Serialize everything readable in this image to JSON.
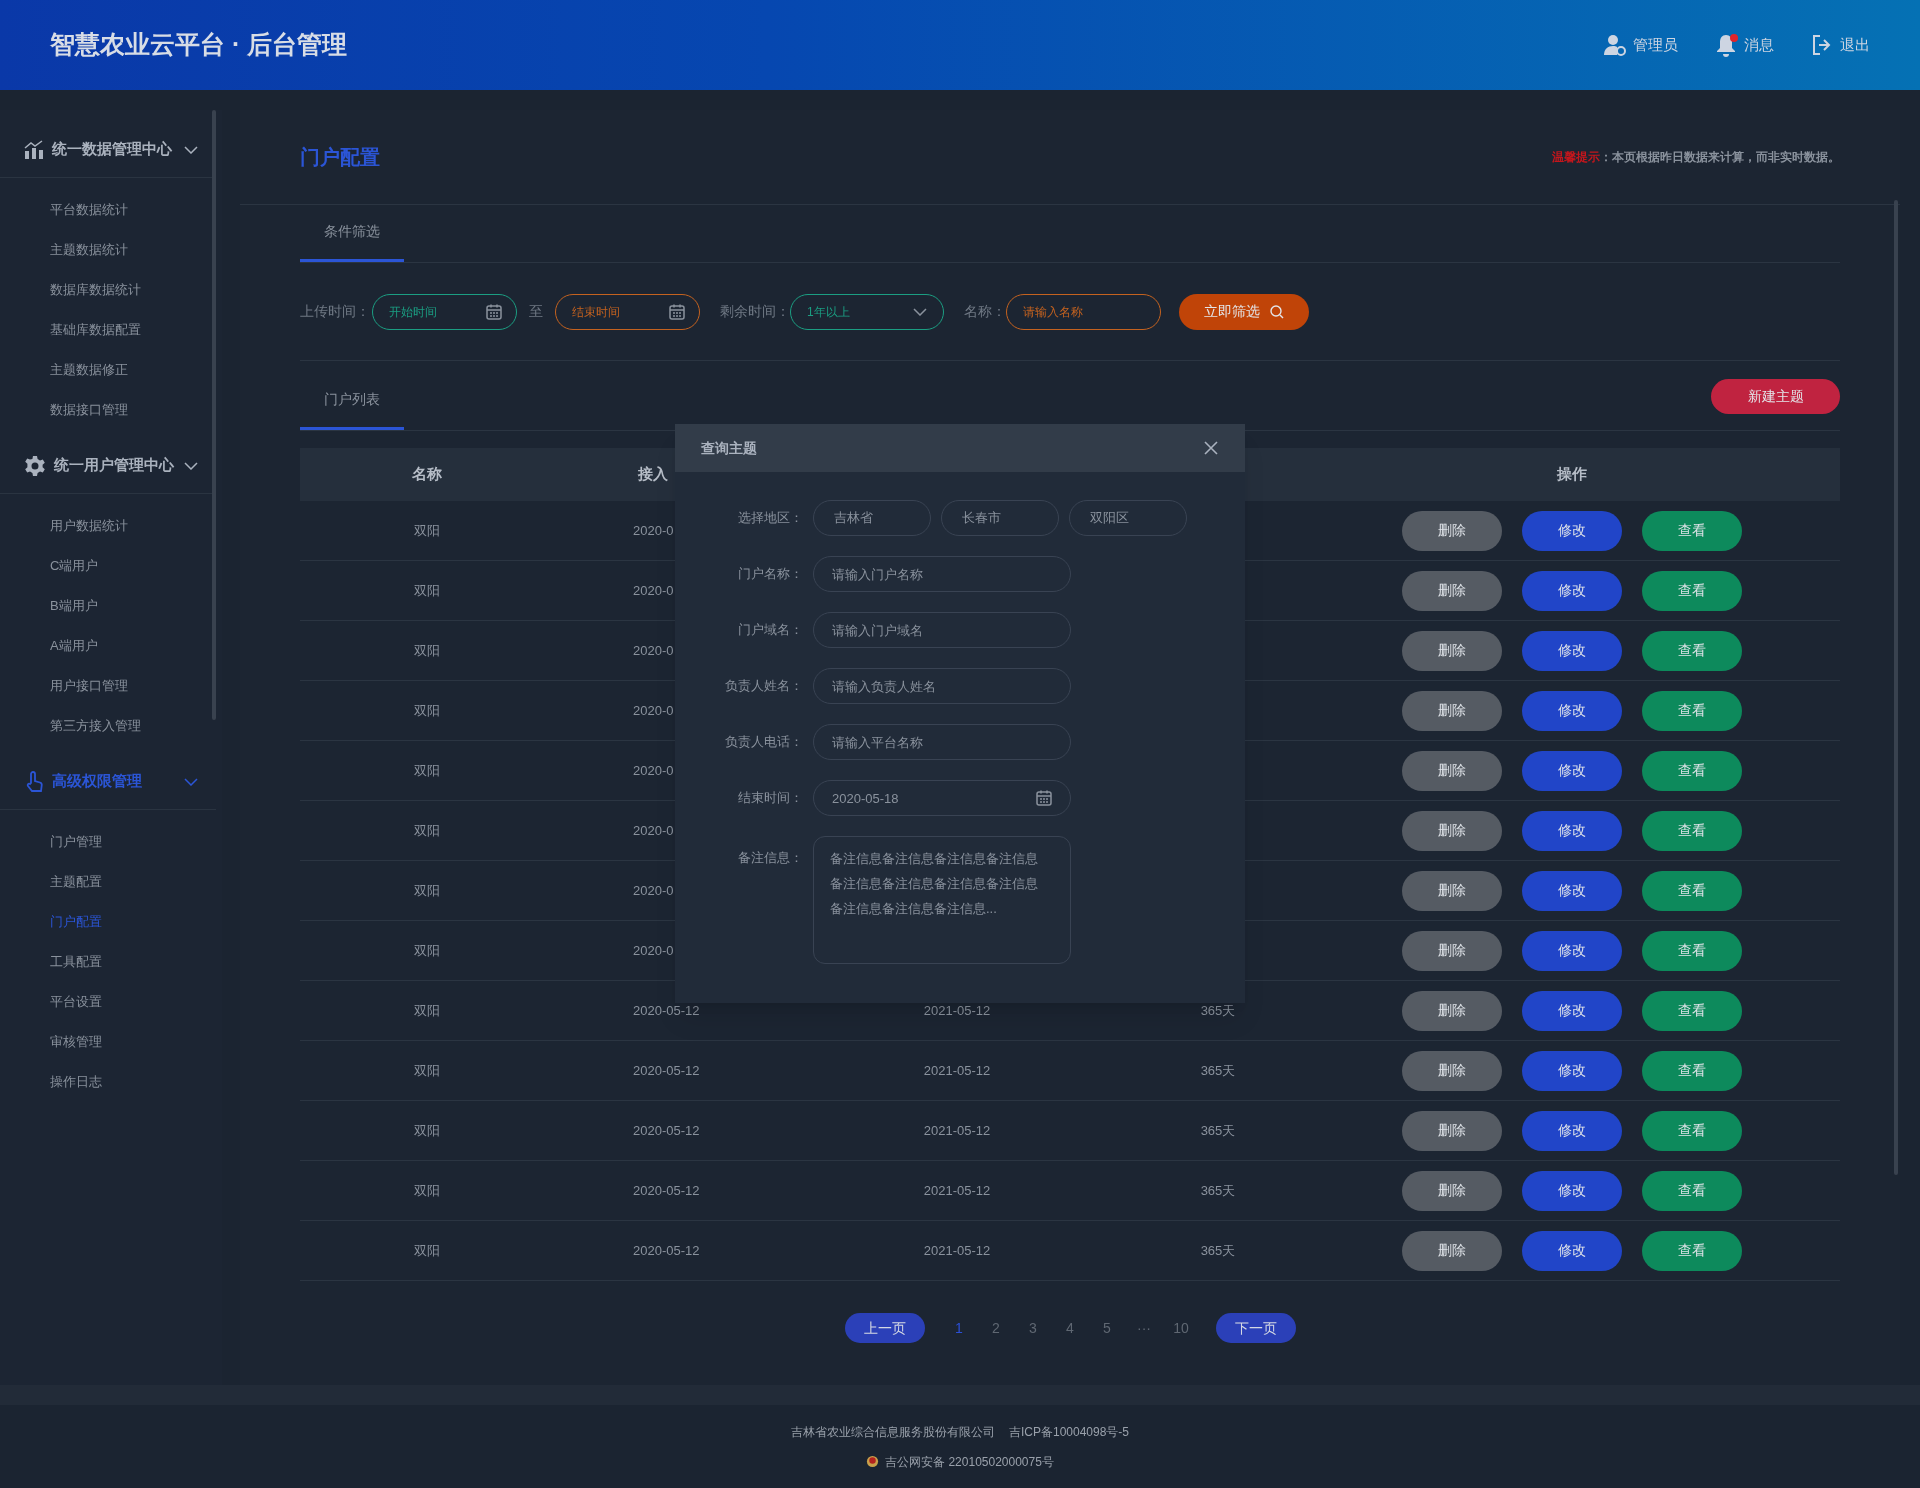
{
  "header": {
    "title": "智慧农业云平台 · 后台管理",
    "actions": [
      {
        "kind": "user",
        "label": "管理员",
        "badge": false
      },
      {
        "kind": "bell",
        "label": "消息",
        "badge": true
      },
      {
        "kind": "exit",
        "label": "退出",
        "badge": false
      }
    ]
  },
  "sidebar": {
    "groups": [
      {
        "title": "统一数据管理中心",
        "expanded": true,
        "selected": false,
        "items": [
          {
            "label": "平台数据统计",
            "selected": false
          },
          {
            "label": "主题数据统计",
            "selected": false
          },
          {
            "label": "数据库数据统计",
            "selected": false
          },
          {
            "label": "基础库数据配置",
            "selected": false
          },
          {
            "label": "主题数据修正",
            "selected": false
          },
          {
            "label": "数据接口管理",
            "selected": false
          }
        ]
      },
      {
        "title": "统一用户管理中心",
        "expanded": true,
        "selected": false,
        "items": [
          {
            "label": "用户数据统计",
            "selected": false
          },
          {
            "label": "C端用户",
            "selected": false
          },
          {
            "label": "B端用户",
            "selected": false
          },
          {
            "label": "A端用户",
            "selected": false
          },
          {
            "label": "用户接口管理",
            "selected": false
          },
          {
            "label": "第三方接入管理",
            "selected": false
          }
        ]
      },
      {
        "title": "高级权限管理",
        "expanded": true,
        "selected": true,
        "items": [
          {
            "label": "门户管理",
            "selected": false
          },
          {
            "label": "主题配置",
            "selected": false
          },
          {
            "label": "门户配置",
            "selected": true
          },
          {
            "label": "工具配置",
            "selected": false
          },
          {
            "label": "平台设置",
            "selected": false
          },
          {
            "label": "审核管理",
            "selected": false
          },
          {
            "label": "操作日志",
            "selected": false
          }
        ]
      }
    ]
  },
  "page": {
    "title": "门户配置",
    "notice_label": "温馨提示",
    "notice_text": "：本页根据昨日数据来计算，而非实时数据。"
  },
  "filter_tab": {
    "label": "条件筛选",
    "selected": true
  },
  "filters": {
    "upload_label": "上传时间：",
    "start_placeholder": "开始时间",
    "separator": "至",
    "end_placeholder": "结束时间",
    "remaining_label": "剩余时间：",
    "remaining_value": "1年以上",
    "name_label": "名称：",
    "name_placeholder": "请输入名称",
    "submit": "立即筛选"
  },
  "list_tab": {
    "label": "门户列表",
    "selected": true
  },
  "new_button": "新建主题",
  "table": {
    "columns": [
      "名称",
      "接入",
      "",
      "",
      "操作"
    ],
    "rows": [
      {
        "cells": [
          "双阳",
          "2020-0",
          "",
          "",
          ""
        ],
        "actions": [
          "删除",
          "修改",
          "查看"
        ]
      },
      {
        "cells": [
          "双阳",
          "2020-0",
          "",
          "",
          ""
        ],
        "actions": [
          "删除",
          "修改",
          "查看"
        ]
      },
      {
        "cells": [
          "双阳",
          "2020-0",
          "",
          "",
          ""
        ],
        "actions": [
          "删除",
          "修改",
          "查看"
        ]
      },
      {
        "cells": [
          "双阳",
          "2020-0",
          "",
          "",
          ""
        ],
        "actions": [
          "删除",
          "修改",
          "查看"
        ]
      },
      {
        "cells": [
          "双阳",
          "2020-0",
          "",
          "",
          ""
        ],
        "actions": [
          "删除",
          "修改",
          "查看"
        ]
      },
      {
        "cells": [
          "双阳",
          "2020-0",
          "",
          "",
          ""
        ],
        "actions": [
          "删除",
          "修改",
          "查看"
        ]
      },
      {
        "cells": [
          "双阳",
          "2020-0",
          "",
          "",
          ""
        ],
        "actions": [
          "删除",
          "修改",
          "查看"
        ]
      },
      {
        "cells": [
          "双阳",
          "2020-0",
          "",
          "",
          ""
        ],
        "actions": [
          "删除",
          "修改",
          "查看"
        ]
      },
      {
        "cells": [
          "双阳",
          "2020-05-12",
          "2021-05-12",
          "365天",
          ""
        ],
        "actions": [
          "删除",
          "修改",
          "查看"
        ]
      },
      {
        "cells": [
          "双阳",
          "2020-05-12",
          "2021-05-12",
          "365天",
          ""
        ],
        "actions": [
          "删除",
          "修改",
          "查看"
        ]
      },
      {
        "cells": [
          "双阳",
          "2020-05-12",
          "2021-05-12",
          "365天",
          ""
        ],
        "actions": [
          "删除",
          "修改",
          "查看"
        ]
      },
      {
        "cells": [
          "双阳",
          "2020-05-12",
          "2021-05-12",
          "365天",
          ""
        ],
        "actions": [
          "删除",
          "修改",
          "查看"
        ]
      },
      {
        "cells": [
          "双阳",
          "2020-05-12",
          "2021-05-12",
          "365天",
          ""
        ],
        "actions": [
          "删除",
          "修改",
          "查看"
        ]
      }
    ]
  },
  "pagination": {
    "prev": "上一页",
    "next": "下一页",
    "pages": [
      {
        "label": "1",
        "selected": true
      },
      {
        "label": "2",
        "selected": false
      },
      {
        "label": "3",
        "selected": false
      },
      {
        "label": "4",
        "selected": false
      },
      {
        "label": "5",
        "selected": false
      },
      {
        "label": "···",
        "selected": false
      },
      {
        "label": "10",
        "selected": false
      }
    ]
  },
  "modal": {
    "title": "查询主题",
    "region_label": "选择地区：",
    "regions": [
      "吉林省",
      "长春市",
      "双阳区"
    ],
    "fields": [
      {
        "kind": "text",
        "label": "门户名称：",
        "placeholder": "请输入门户名称"
      },
      {
        "kind": "text",
        "label": "门户域名：",
        "placeholder": "请输入门户域名"
      },
      {
        "kind": "text",
        "label": "负责人姓名：",
        "placeholder": "请输入负责人姓名"
      },
      {
        "kind": "text",
        "label": "负责人电话：",
        "placeholder": "请输入平台名称"
      },
      {
        "kind": "date",
        "label": "结束时间：",
        "value": "2020-05-18"
      }
    ],
    "notes_label": "备注信息：",
    "notes_value": "备注信息备注信息备注信息备注信息备注信息备注信息备注信息备注信息备注信息备注信息备注信息..."
  },
  "footer": {
    "company": "吉林省农业综合信息服务股份有限公司",
    "icp": "吉ICP备10004098号-5",
    "police": "吉公网安备 22010502000075号"
  }
}
